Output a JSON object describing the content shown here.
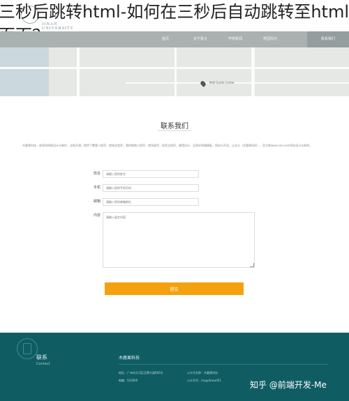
{
  "overlay_title": "三秒后跳转html-如何在三秒后自动跳转至html 页面？",
  "header": {
    "university_en": "JINAN UNIVERSITY"
  },
  "nav": {
    "items": [
      "首页",
      "关于暨大",
      "学校新闻",
      "校园风光",
      "联系我们"
    ],
    "active_index": 4
  },
  "map": {
    "place_label": "Mall Guide Center"
  },
  "contact": {
    "title": "联系我们",
    "intro": "木鹿果科技，收获的网格设计与制作，全程开通，提供了整套小程序，商城全程序，我的微商小程序，商场程序，投资全程序，餐馆设计，全家好网格模板，网站与开发。让业与（木鹿果科技），官方和www.seo.com网站设计与制作。",
    "form": {
      "name_label": "姓名",
      "name_placeholder": "请输入您的姓名",
      "phone_label": "手机",
      "phone_placeholder": "请输入您的手机号码",
      "email_label": "邮箱",
      "email_placeholder": "请输入您的邮箱地址",
      "content_label": "内容",
      "content_placeholder": "请输入留言内容",
      "submit_label": "提交"
    }
  },
  "footer": {
    "contact_title": "联系",
    "contact_en": "Contact",
    "company": "木鹿果科技",
    "address": "地址：广州市天河区石牌大道666号",
    "postcode": "邮编：510000",
    "public_label": "公众号名称：木鹿果科技",
    "public_id": "公众号号：mugufuwu001"
  },
  "watermark": "知乎 @前端开发-Me"
}
